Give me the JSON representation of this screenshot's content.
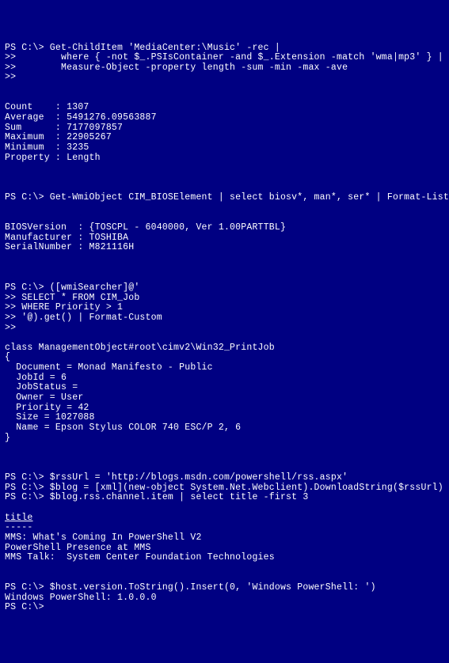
{
  "lines": [
    "PS C:\\> Get-ChildItem 'MediaCenter:\\Music' -rec |",
    ">>        where { -not $_.PSIsContainer -and $_.Extension -match 'wma|mp3' } |",
    ">>        Measure-Object -property length -sum -min -max -ave",
    ">>",
    "",
    "",
    "Count    : 1307",
    "Average  : 5491276.09563887",
    "Sum      : 7177097857",
    "Maximum  : 22905267",
    "Minimum  : 3235",
    "Property : Length",
    "",
    "",
    "",
    "PS C:\\> Get-WmiObject CIM_BIOSElement | select biosv*, man*, ser* | Format-List",
    "",
    "",
    "BIOSVersion  : {TOSCPL - 6040000, Ver 1.00PARTTBL}",
    "Manufacturer : TOSHIBA",
    "SerialNumber : M821116H",
    "",
    "",
    "",
    "PS C:\\> ([wmiSearcher]@'",
    ">> SELECT * FROM CIM_Job",
    ">> WHERE Priority > 1",
    ">> '@).get() | Format-Custom",
    ">>",
    "",
    "class ManagementObject#root\\cimv2\\Win32_PrintJob",
    "{",
    "  Document = Monad Manifesto - Public",
    "  JobId = 6",
    "  JobStatus =",
    "  Owner = User",
    "  Priority = 42",
    "  Size = 1027088",
    "  Name = Epson Stylus COLOR 740 ESC/P 2, 6",
    "}",
    "",
    "",
    "",
    "PS C:\\> $rssUrl = 'http://blogs.msdn.com/powershell/rss.aspx'",
    "PS C:\\> $blog = [xml](new-object System.Net.Webclient).DownloadString($rssUrl)",
    "PS C:\\> $blog.rss.channel.item | select title -first 3",
    "",
    "title",
    "-----",
    "MMS: What's Coming In PowerShell V2",
    "PowerShell Presence at MMS",
    "MMS Talk:  System Center Foundation Technologies",
    "",
    "",
    "PS C:\\> $host.version.ToString().Insert(0, 'Windows PowerShell: ')",
    "Windows PowerShell: 1.0.0.0",
    "PS C:\\>"
  ],
  "underline_indices": [
    47
  ]
}
